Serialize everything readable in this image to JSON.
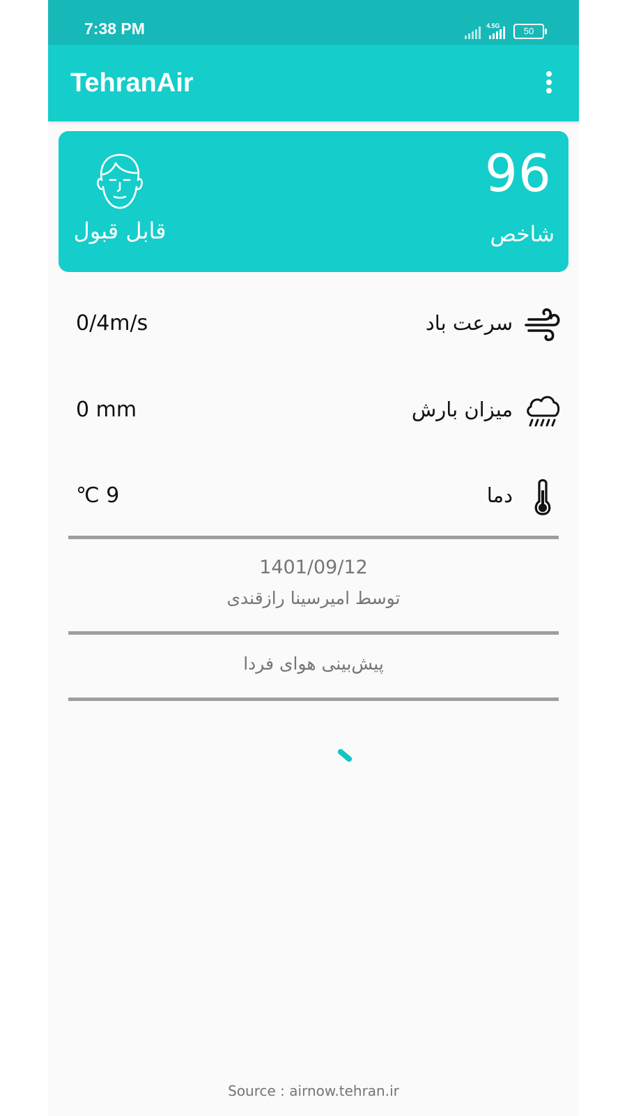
{
  "status_bar": {
    "time": "7:38 PM",
    "network": "4.5G",
    "battery": "50"
  },
  "app_bar": {
    "title": "TehranAir",
    "menu_icon": "more-vert-icon"
  },
  "aqi_card": {
    "value": "96",
    "index_label": "شاخص",
    "status": "قابل قبول",
    "status_icon": "face-icon",
    "background_color": "#15cdca"
  },
  "weather": [
    {
      "icon": "wind-icon",
      "label": "سرعت باد",
      "value": "0/4m/s"
    },
    {
      "icon": "rain-cloud-icon",
      "label": "میزان بارش",
      "value": "0 mm"
    },
    {
      "icon": "thermometer-icon",
      "label": "دما",
      "value": "℃ 9"
    }
  ],
  "info": {
    "date": "1401/09/12",
    "author": "توسط امیرسینا رازقندی"
  },
  "forecast": {
    "label": "پیش‌بینی هوای فردا"
  },
  "loading_icon": "loading-spinner-icon",
  "footer": {
    "source": "Source : airnow.tehran.ir"
  },
  "colors": {
    "status_bar": "#17b8b8",
    "accent": "#15cdca",
    "divider": "#9e9e9e",
    "muted_text": "#757575"
  }
}
